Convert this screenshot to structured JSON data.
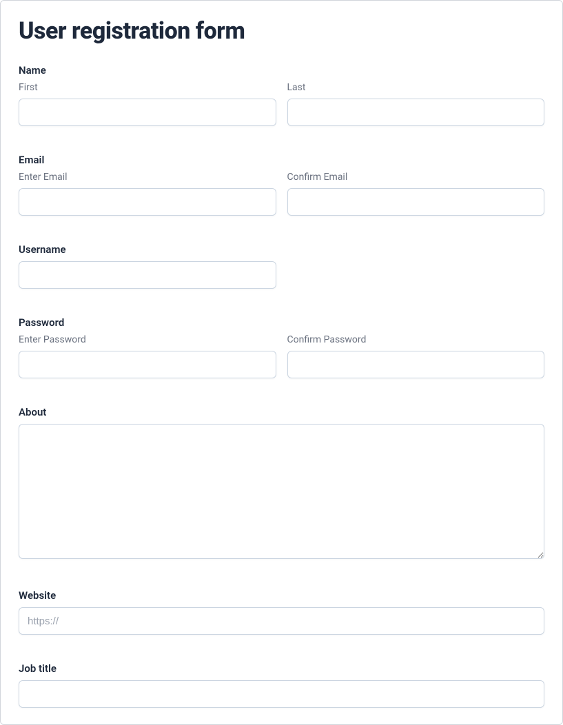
{
  "title": "User registration form",
  "name": {
    "label": "Name",
    "first_label": "First",
    "last_label": "Last",
    "first_value": "",
    "last_value": ""
  },
  "email": {
    "label": "Email",
    "enter_label": "Enter Email",
    "confirm_label": "Confirm Email",
    "enter_value": "",
    "confirm_value": ""
  },
  "username": {
    "label": "Username",
    "value": ""
  },
  "password": {
    "label": "Password",
    "enter_label": "Enter Password",
    "confirm_label": "Confirm Password",
    "enter_value": "",
    "confirm_value": ""
  },
  "about": {
    "label": "About",
    "value": ""
  },
  "website": {
    "label": "Website",
    "placeholder": "https://",
    "value": ""
  },
  "jobtitle": {
    "label": "Job title",
    "value": ""
  }
}
